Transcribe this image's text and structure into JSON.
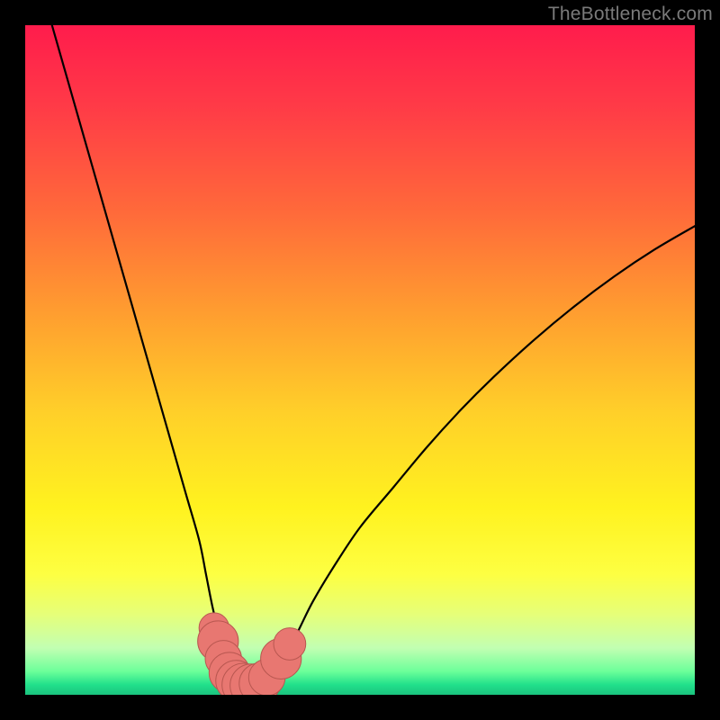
{
  "watermark": "TheBottleneck.com",
  "chart_data": {
    "type": "line",
    "title": "",
    "xlabel": "",
    "ylabel": "",
    "xlim": [
      0,
      100
    ],
    "ylim": [
      0,
      100
    ],
    "curve": {
      "name": "bottleneck-curve",
      "x": [
        4,
        6,
        8,
        10,
        12,
        14,
        16,
        18,
        20,
        22,
        24,
        26,
        27,
        28,
        29,
        30,
        31,
        32,
        33,
        34,
        35,
        36,
        37,
        39,
        41,
        43,
        46,
        50,
        55,
        60,
        65,
        70,
        76,
        82,
        88,
        94,
        100
      ],
      "y": [
        100,
        93,
        86,
        79,
        72,
        65,
        58,
        51,
        44,
        37,
        30,
        23,
        18,
        13,
        9,
        6,
        3.8,
        2.4,
        1.6,
        1.2,
        1.4,
        2.0,
        3.2,
        6,
        10,
        14,
        19,
        25,
        31,
        37,
        42.5,
        47.5,
        53,
        58,
        62.5,
        66.5,
        70
      ]
    },
    "annotations": [
      {
        "x": 28.2,
        "y": 10.0,
        "r": 1.4
      },
      {
        "x": 28.8,
        "y": 8.0,
        "r": 1.9
      },
      {
        "x": 29.6,
        "y": 5.4,
        "r": 1.7
      },
      {
        "x": 30.5,
        "y": 3.3,
        "r": 1.9
      },
      {
        "x": 31.5,
        "y": 2.1,
        "r": 1.9
      },
      {
        "x": 32.6,
        "y": 1.5,
        "r": 2.0
      },
      {
        "x": 33.8,
        "y": 1.4,
        "r": 2.0
      },
      {
        "x": 35.0,
        "y": 1.7,
        "r": 1.9
      },
      {
        "x": 36.1,
        "y": 2.6,
        "r": 1.7
      },
      {
        "x": 38.2,
        "y": 5.4,
        "r": 1.9
      },
      {
        "x": 39.5,
        "y": 7.6,
        "r": 1.5
      }
    ],
    "gradient_stops": [
      {
        "pct": 0,
        "color": "#ff1c4c"
      },
      {
        "pct": 50,
        "color": "#ffc028"
      },
      {
        "pct": 80,
        "color": "#fff21f"
      },
      {
        "pct": 97,
        "color": "#40e890"
      },
      {
        "pct": 100,
        "color": "#1bc37e"
      }
    ]
  }
}
